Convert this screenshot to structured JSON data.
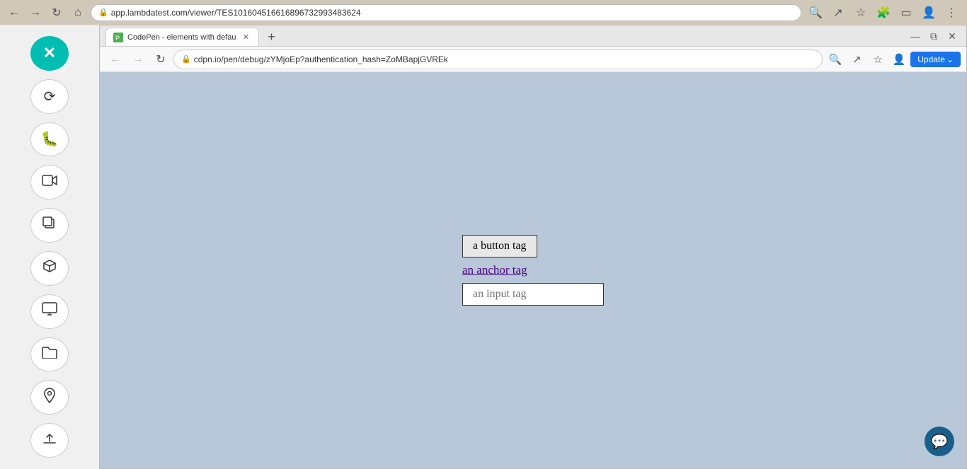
{
  "outer_browser": {
    "address": "app.lambdatest.com/viewer/TES101604516616896732993483624",
    "nav_back": "←",
    "nav_forward": "→",
    "nav_refresh": "↻",
    "nav_home": "⌂"
  },
  "sidebar": {
    "close_label": "✕",
    "buttons": [
      {
        "icon": "↻",
        "name": "sync-icon"
      },
      {
        "icon": "🐛",
        "name": "bug-icon"
      },
      {
        "icon": "📹",
        "name": "video-icon"
      },
      {
        "icon": "⧉",
        "name": "copy-icon"
      },
      {
        "icon": "◻",
        "name": "box-icon"
      },
      {
        "icon": "🖥",
        "name": "monitor-icon"
      },
      {
        "icon": "📁",
        "name": "folder-icon"
      },
      {
        "icon": "📍",
        "name": "location-icon"
      },
      {
        "icon": "↑",
        "name": "upload-icon"
      }
    ]
  },
  "inner_browser": {
    "tab_label": "CodePen - elements with defau",
    "tab_url": "cdpn.io/pen/debug/zYMjoEp?authentication_hash=ZoMBapjGVREk",
    "update_btn": "Update"
  },
  "demo": {
    "button_label": "a button tag",
    "anchor_label": "an anchor tag",
    "input_placeholder": "an input tag"
  }
}
